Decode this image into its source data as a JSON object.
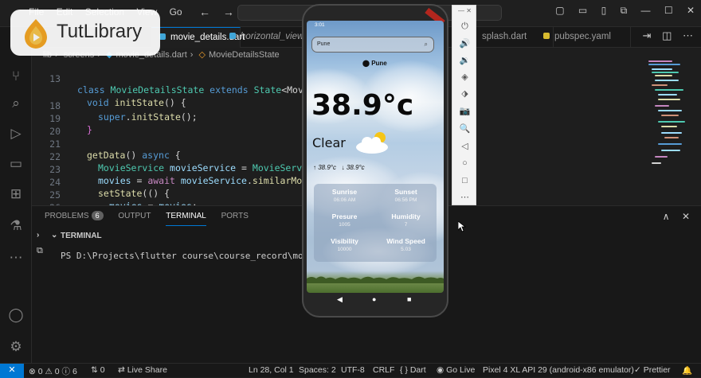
{
  "menu": [
    "File",
    "Edit",
    "Selection",
    "View",
    "Go"
  ],
  "nav": {
    "back": "←",
    "forward": "→"
  },
  "window_controls": [
    "▢",
    "▭",
    "▯",
    "⧉",
    "—",
    "☐",
    "✕"
  ],
  "logo": {
    "text": "TutLibrary"
  },
  "tabs": [
    {
      "label": "movie_details.dart",
      "active": true,
      "color": "#40a6d8"
    },
    {
      "label": "horizontal_view_",
      "active": false,
      "color": "#40a6d8",
      "italic": true
    },
    {
      "label": "splash.dart",
      "active": false,
      "color": "#40a6d8"
    },
    {
      "label": "pubspec.yaml",
      "active": false,
      "color": "#d7ba2f"
    }
  ],
  "editor_actions": [
    "⇥",
    "◫",
    "⋯"
  ],
  "breadcrumb": {
    "p1": "lib",
    "p2": "screens",
    "p3": "movie_details.dart",
    "p4": "MovieDetailsState"
  },
  "code": {
    "l13": "13",
    "l18": "18",
    "l19": "19",
    "l20": "20",
    "l21": "21",
    "l22": "22",
    "l23": "23",
    "l24": "24",
    "l25": "25",
    "l26": "26",
    "class_line": {
      "a": "class ",
      "b": "MovieDetailsState",
      "c": " extends ",
      "d": "State",
      "e": "<MovieDe"
    },
    "initstate": {
      "a": "void ",
      "b": "initState",
      "c": "() {"
    },
    "super_line": {
      "a": "super",
      "b": ".",
      "c": "initState",
      "d": "();"
    },
    "close1": "}",
    "getdata": {
      "a": "getData",
      "b": "() ",
      "c": "async",
      "d": " {"
    },
    "ms_line": {
      "a": "MovieService ",
      "b": "movieService",
      "c": " = ",
      "d": "MovieService",
      "e": "("
    },
    "movies_line": {
      "a": "movies",
      "b": " = ",
      "c": "await ",
      "d": "movieService",
      "e": ".",
      "f": "similarMovies"
    },
    "setstate": {
      "a": "setState",
      "b": "(() {"
    },
    "assign": {
      "a": "movies",
      "b": " = ",
      "c": "movies",
      "d": ";"
    },
    "close2": "});"
  },
  "panel": {
    "tabs": [
      {
        "label": "PROBLEMS",
        "badge": "6"
      },
      {
        "label": "OUTPUT"
      },
      {
        "label": "TERMINAL",
        "active": true
      },
      {
        "label": "PORTS"
      }
    ],
    "section": "TERMINAL",
    "prompt": "PS D:\\Projects\\flutter course\\course_record\\movie_a",
    "controls": [
      "∧",
      "✕"
    ]
  },
  "statusbar": {
    "remote": "✕",
    "problems": "⊗ 0 ⚠ 0 ⓘ 6",
    "ports": "⇅ 0",
    "live_share": "Live Share",
    "position": "Ln 28, Col 1",
    "spaces": "Spaces: 2",
    "encoding": "UTF-8",
    "eol": "CRLF",
    "language": "{ } Dart",
    "golive": "Go Live",
    "device": "Pixel 4 XL API 29 (android-x86 emulator)",
    "prettier": "✓ Prettier",
    "bell": "🔔"
  },
  "emulator_toolbar": [
    "⏻",
    "🔊",
    "🔉",
    "◈",
    "⬗",
    "📷",
    "🔍",
    "◁",
    "○",
    "□",
    "⋯"
  ],
  "emulator_close": "— ✕",
  "app": {
    "status_time": "3:01",
    "search_text": "Pune",
    "location": "Pune",
    "temperature": "38.9°c",
    "condition": "Clear",
    "max_temp": "↑ 38.9°c",
    "min_temp": "↓ 38.9°c",
    "details": [
      {
        "label": "Sunrise",
        "value": "06:06 AM"
      },
      {
        "label": "Sunset",
        "value": "06:56 PM"
      },
      {
        "label": "Presure",
        "value": "1005"
      },
      {
        "label": "Humidity",
        "value": "7"
      },
      {
        "label": "Visibility",
        "value": "10000"
      },
      {
        "label": "Wind Speed",
        "value": "5.03"
      }
    ],
    "nav": [
      "◀",
      "●",
      "■"
    ]
  }
}
